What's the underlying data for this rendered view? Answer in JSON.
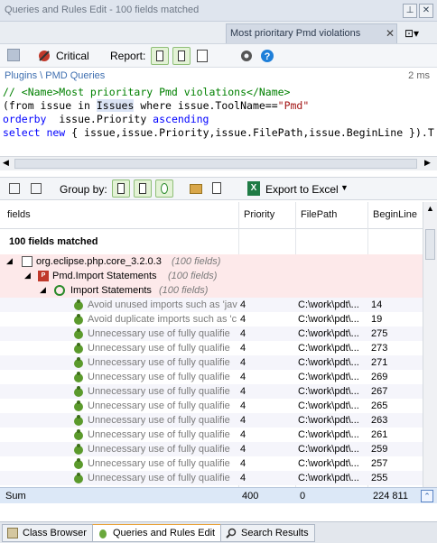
{
  "window": {
    "title": "Queries and Rules Edit  -  100 fields matched"
  },
  "doc_tab": {
    "label": "Most prioritary Pmd violations"
  },
  "toolbar": {
    "critical_label": "Critical",
    "report_label": "Report:"
  },
  "breadcrumb": {
    "path": "Plugins \\ PMD Queries",
    "duration": "2 ms"
  },
  "code": {
    "line1": "// <Name>Most prioritary Pmd violations</Name>",
    "line2_a": "(from issue in ",
    "line2_issues": "Issues",
    "line2_b": " where issue.ToolName==",
    "line2_str": "\"Pmd\"",
    "line3_kw": "orderby",
    "line3_rest": "  issue.Priority ",
    "line3_kw2": "ascending",
    "line4_kw": "select new",
    "line4_rest": " { issue,issue.Priority,issue.FilePath,issue.BeginLine }).T"
  },
  "gridbar": {
    "group_by_label": "Group by:",
    "export_label": "Export to Excel"
  },
  "table": {
    "headers": {
      "fields": "fields",
      "priority": "Priority",
      "filepath": "FilePath",
      "beginline": "BeginLine"
    },
    "matched_label": "100 fields matched",
    "group1": {
      "name": "org.eclipse.php.core_3.2.0.3",
      "count": "(100 fields)"
    },
    "group2": {
      "name": "Pmd.Import Statements",
      "count": "(100 fields)"
    },
    "group3": {
      "name": "Import Statements",
      "count": "(100 fields)"
    },
    "rows": [
      {
        "field": "Avoid unused imports such as 'jav",
        "priority": "4",
        "filepath": "C:\\work\\pdt\\...",
        "beginline": "14"
      },
      {
        "field": "Avoid duplicate imports such as 'c",
        "priority": "4",
        "filepath": "C:\\work\\pdt\\...",
        "beginline": "19"
      },
      {
        "field": "Unnecessary use of fully qualifie",
        "priority": "4",
        "filepath": "C:\\work\\pdt\\...",
        "beginline": "275"
      },
      {
        "field": "Unnecessary use of fully qualifie",
        "priority": "4",
        "filepath": "C:\\work\\pdt\\...",
        "beginline": "273"
      },
      {
        "field": "Unnecessary use of fully qualifie",
        "priority": "4",
        "filepath": "C:\\work\\pdt\\...",
        "beginline": "271"
      },
      {
        "field": "Unnecessary use of fully qualifie",
        "priority": "4",
        "filepath": "C:\\work\\pdt\\...",
        "beginline": "269"
      },
      {
        "field": "Unnecessary use of fully qualifie",
        "priority": "4",
        "filepath": "C:\\work\\pdt\\...",
        "beginline": "267"
      },
      {
        "field": "Unnecessary use of fully qualifie",
        "priority": "4",
        "filepath": "C:\\work\\pdt\\...",
        "beginline": "265"
      },
      {
        "field": "Unnecessary use of fully qualifie",
        "priority": "4",
        "filepath": "C:\\work\\pdt\\...",
        "beginline": "263"
      },
      {
        "field": "Unnecessary use of fully qualifie",
        "priority": "4",
        "filepath": "C:\\work\\pdt\\...",
        "beginline": "261"
      },
      {
        "field": "Unnecessary use of fully qualifie",
        "priority": "4",
        "filepath": "C:\\work\\pdt\\...",
        "beginline": "259"
      },
      {
        "field": "Unnecessary use of fully qualifie",
        "priority": "4",
        "filepath": "C:\\work\\pdt\\...",
        "beginline": "257"
      },
      {
        "field": "Unnecessary use of fully qualifie",
        "priority": "4",
        "filepath": "C:\\work\\pdt\\...",
        "beginline": "255"
      }
    ],
    "sum": {
      "label": "Sum",
      "priority": "400",
      "filepath": "0",
      "beginline": "224 811"
    }
  },
  "bottom_tabs": {
    "class_browser": "Class Browser",
    "queries_rules": "Queries and Rules Edit",
    "search_results": "Search Results"
  },
  "colors": {
    "accent": "#3f6fb0",
    "group_bg": "#fde9ea",
    "sum_bg": "#dce8f7",
    "row_alt": "#f5f5fb"
  },
  "icons": [
    "save-icon",
    "critical-icon",
    "report-icon",
    "gear-icon",
    "help-icon",
    "pin-icon",
    "close-icon",
    "excel-icon",
    "bug-icon",
    "folder-icon",
    "page-icon"
  ]
}
